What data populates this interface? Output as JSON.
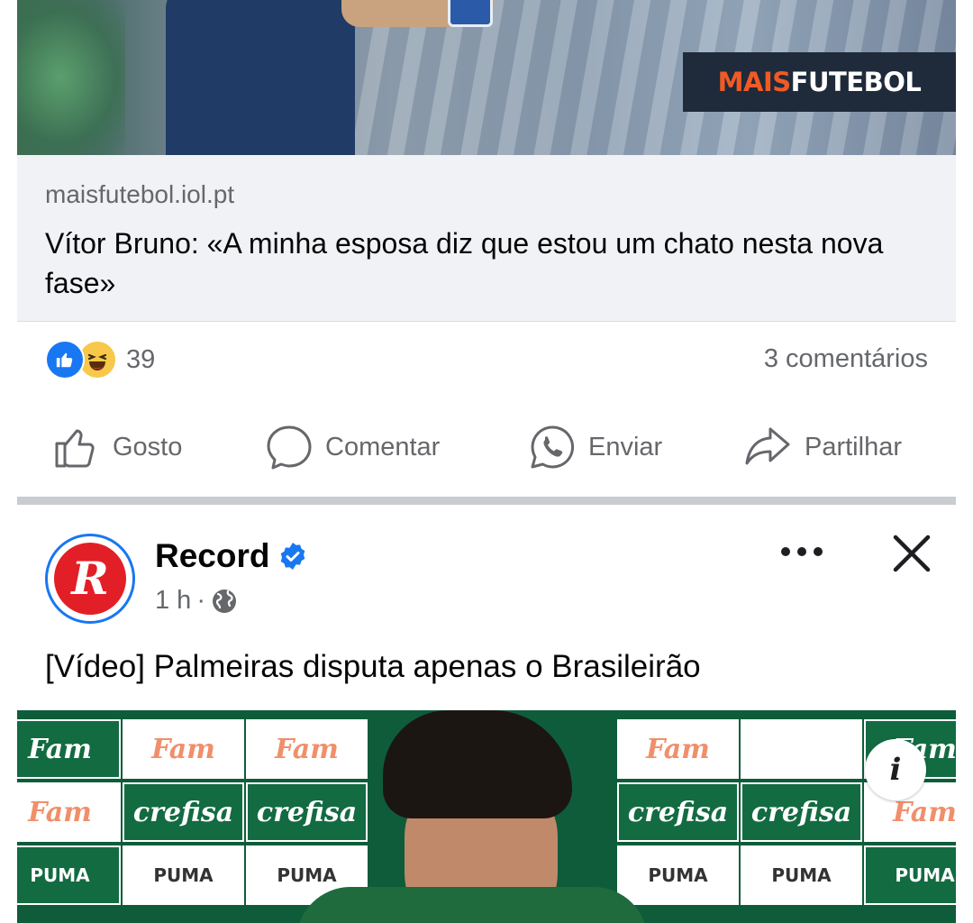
{
  "post1": {
    "image_brand": {
      "part1": "MAIS",
      "part2": "FUTEBOL"
    },
    "link": {
      "domain": "maisfutebol.iol.pt",
      "title": "Vítor Bruno: «A minha esposa diz que estou um chato nesta nova fase»"
    },
    "reactions": {
      "count": "39",
      "icons": [
        "like-icon",
        "haha-icon"
      ]
    },
    "comments": "3 comentários",
    "actions": [
      {
        "label": "Gosto",
        "icon": "thumbs-up-icon"
      },
      {
        "label": "Comentar",
        "icon": "comment-icon"
      },
      {
        "label": "Enviar",
        "icon": "whatsapp-icon"
      },
      {
        "label": "Partilhar",
        "icon": "share-icon"
      }
    ]
  },
  "post2": {
    "page_name": "Record",
    "verified": true,
    "time": "1 h",
    "audience_icon": "globe-icon",
    "text": "[Vídeo] Palmeiras disputa apenas o Brasileirão",
    "video": {
      "sponsor_tiles": [
        "Fam",
        "crefisa",
        "PUMA"
      ],
      "info_label": "i"
    }
  },
  "colors": {
    "accent": "#1877f2",
    "secondary_text": "#65676b",
    "card_bg": "#f0f2f5",
    "record_red": "#e21f26",
    "brand_orange": "#f15a24"
  }
}
